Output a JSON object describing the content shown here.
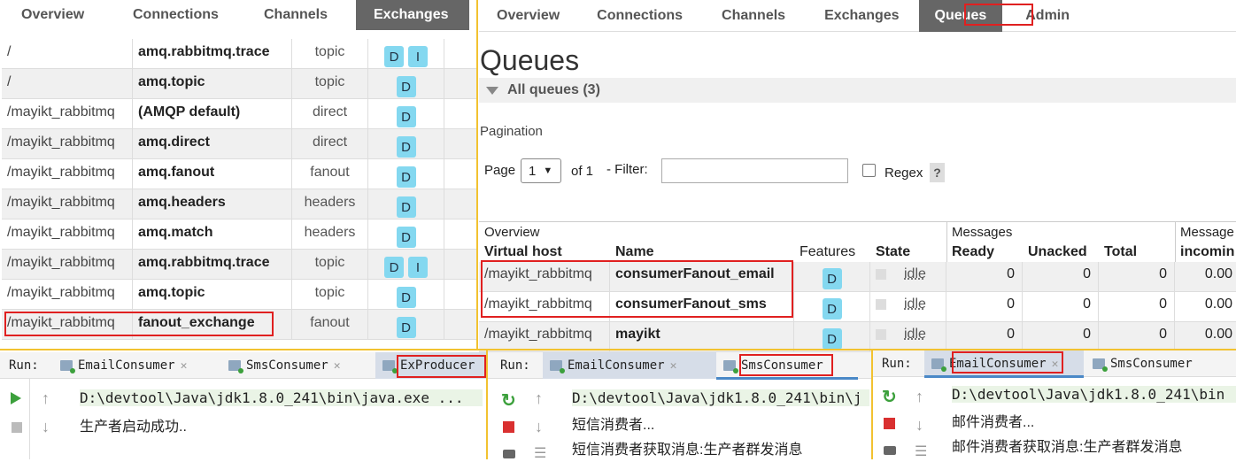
{
  "left_nav": {
    "items": [
      "Overview",
      "Connections",
      "Channels",
      "Exchanges"
    ],
    "selected": "Exchanges"
  },
  "exchanges": [
    {
      "vhost": "/",
      "name": "amq.rabbitmq.trace",
      "type": "topic",
      "features": [
        "D",
        "I"
      ]
    },
    {
      "vhost": "/",
      "name": "amq.topic",
      "type": "topic",
      "features": [
        "D"
      ]
    },
    {
      "vhost": "/mayikt_rabbitmq",
      "name": "(AMQP default)",
      "type": "direct",
      "features": [
        "D"
      ]
    },
    {
      "vhost": "/mayikt_rabbitmq",
      "name": "amq.direct",
      "type": "direct",
      "features": [
        "D"
      ]
    },
    {
      "vhost": "/mayikt_rabbitmq",
      "name": "amq.fanout",
      "type": "fanout",
      "features": [
        "D"
      ]
    },
    {
      "vhost": "/mayikt_rabbitmq",
      "name": "amq.headers",
      "type": "headers",
      "features": [
        "D"
      ]
    },
    {
      "vhost": "/mayikt_rabbitmq",
      "name": "amq.match",
      "type": "headers",
      "features": [
        "D"
      ]
    },
    {
      "vhost": "/mayikt_rabbitmq",
      "name": "amq.rabbitmq.trace",
      "type": "topic",
      "features": [
        "D",
        "I"
      ]
    },
    {
      "vhost": "/mayikt_rabbitmq",
      "name": "amq.topic",
      "type": "topic",
      "features": [
        "D"
      ]
    },
    {
      "vhost": "/mayikt_rabbitmq",
      "name": "fanout_exchange",
      "type": "fanout",
      "features": [
        "D"
      ]
    }
  ],
  "right_nav": {
    "items": [
      "Overview",
      "Connections",
      "Channels",
      "Exchanges",
      "Queues",
      "Admin"
    ],
    "selected": "Queues"
  },
  "queues_page": {
    "title": "Queues",
    "all_queues": "All queues (3)",
    "pagination_label": "Pagination",
    "page_label": "Page",
    "page_value": "1",
    "of_label": "of 1",
    "filter_label": "- Filter:",
    "filter_value": "",
    "regex_label": "Regex",
    "help_label": "?",
    "group_headers": [
      "Overview",
      "Messages",
      "Message"
    ],
    "columns": [
      "Virtual host",
      "Name",
      "Features",
      "State",
      "Ready",
      "Unacked",
      "Total",
      "incomin"
    ],
    "rows": [
      {
        "vhost": "/mayikt_rabbitmq",
        "name": "consumerFanout_email",
        "feature": "D",
        "state": "idle",
        "ready": "0",
        "unacked": "0",
        "total": "0",
        "incoming": "0.00"
      },
      {
        "vhost": "/mayikt_rabbitmq",
        "name": "consumerFanout_sms",
        "feature": "D",
        "state": "idle",
        "ready": "0",
        "unacked": "0",
        "total": "0",
        "incoming": "0.00"
      },
      {
        "vhost": "/mayikt_rabbitmq",
        "name": "mayikt",
        "feature": "D",
        "state": "idle",
        "ready": "0",
        "unacked": "0",
        "total": "0",
        "incoming": "0.00"
      }
    ]
  },
  "run_panels": [
    {
      "run_label": "Run:",
      "tabs": [
        "EmailConsumer",
        "SmsConsumer",
        "ExProducer"
      ],
      "active_tab": "ExProducer",
      "lines": [
        "D:\\devtool\\Java\\jdk1.8.0_241\\bin\\java.exe ...",
        "生产者启动成功.."
      ]
    },
    {
      "run_label": "Run:",
      "tabs": [
        "EmailConsumer",
        "SmsConsumer"
      ],
      "active_tab": "SmsConsumer",
      "lines": [
        "D:\\devtool\\Java\\jdk1.8.0_241\\bin\\j",
        "短信消费者...",
        "短信消费者获取消息:生产者群发消息"
      ]
    },
    {
      "run_label": "Run:",
      "tabs": [
        "EmailConsumer",
        "SmsConsumer"
      ],
      "active_tab": "EmailConsumer",
      "lines": [
        "D:\\devtool\\Java\\jdk1.8.0_241\\bin",
        "邮件消费者...",
        "邮件消费者获取消息:生产者群发消息"
      ]
    }
  ],
  "colors": {
    "highlight": "#e02020",
    "panel_border": "#f2c230",
    "badge": "#84d8f0",
    "nav_selected": "#666666"
  }
}
